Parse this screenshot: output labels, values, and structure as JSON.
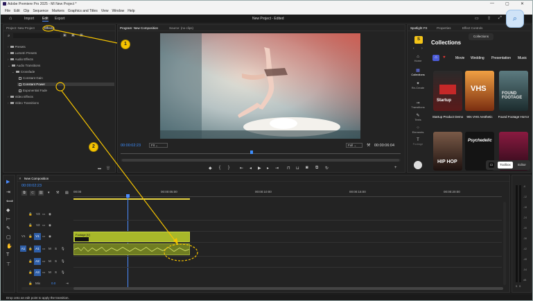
{
  "window": {
    "title": "Adobe Premiere Pro 2025 - MI New Project *",
    "controls": [
      "—",
      "▢",
      "✕"
    ]
  },
  "menu": [
    "File",
    "Edit",
    "Clip",
    "Sequence",
    "Markers",
    "Graphics and Titles",
    "View",
    "Window",
    "Help"
  ],
  "workspace_tabs": [
    "Import",
    "Edit",
    "Export"
  ],
  "project_title": "New Project - Edited",
  "left_panel": {
    "tabs": [
      "Project: New Project",
      "Effects"
    ],
    "tree": [
      {
        "label": "Presets",
        "level": 0
      },
      {
        "label": "Lumetri Presets",
        "level": 0
      },
      {
        "label": "Audio Effects",
        "level": 0
      },
      {
        "label": "Audio Transitions",
        "level": 0
      },
      {
        "label": "Crossfade",
        "level": 1
      },
      {
        "label": "Constant Gain",
        "level": 2
      },
      {
        "label": "Constant Power",
        "level": 2
      },
      {
        "label": "Exponential Fade",
        "level": 2
      },
      {
        "label": "Video Effects",
        "level": 0
      },
      {
        "label": "Video Transitions",
        "level": 0
      }
    ]
  },
  "program_monitor": {
    "tabs": [
      "Program: New Composition",
      "Source: (no clips)"
    ],
    "current_time": "00:00:02:23",
    "fit": "Fit",
    "quality": "Full",
    "duration": "00:00:06:04"
  },
  "right_panel": {
    "tabs": [
      "Spotlight FX",
      "Properties",
      "Effect Controls"
    ],
    "collections_button": "Collections",
    "heading": "Collections",
    "nav_items": [
      "Home",
      "Collections",
      "Re-Create",
      "Transitions",
      "Texts",
      "Elements",
      "Footage"
    ],
    "categories": [
      "Movie",
      "Wedding",
      "Presentation",
      "Music"
    ],
    "cards": [
      {
        "title": "Startup Product Demo",
        "art": "Startup",
        "colors": [
          "#2a2a2a",
          "#b71c1c"
        ]
      },
      {
        "title": "90s VHS Aesthetic",
        "art": "VHS",
        "colors": [
          "#e8742c",
          "#7a2d10"
        ]
      },
      {
        "title": "Found Footage Horror",
        "art": "FOUND FOOTAGE",
        "colors": [
          "#4a6b70",
          "#1c2c2e"
        ]
      }
    ],
    "cards_row2": [
      {
        "art": "HIP HOP",
        "colors": [
          "#6b4a3a",
          "#1e1210"
        ]
      },
      {
        "art": "Psychedelic",
        "colors": [
          "#111111",
          "#222222"
        ]
      },
      {
        "art": "",
        "colors": [
          "#7a1030",
          "#2a0a18"
        ]
      }
    ],
    "toolbox_label": "Toolbox",
    "editor_label": "Editor"
  },
  "timeline": {
    "sequence_tab": "New Composition",
    "current_time": "00:00:02:23",
    "ruler": [
      "00:00",
      "00:00:05:00",
      "00:00:10:00",
      "00:00:15:00",
      "00:00:20:00"
    ],
    "tracks_video": [
      "V3",
      "V2",
      "V1"
    ],
    "tracks_audio": [
      "A1",
      "A2",
      "A3"
    ],
    "mix_label": "Mix",
    "mix_value": "0.0",
    "clip_label": "Footage [V]",
    "meter_labels": [
      "-6",
      "-12",
      "-18",
      "-24",
      "-30",
      "-36",
      "-42",
      "-48",
      "-54",
      "dB"
    ],
    "meter_bottom": [
      "S",
      "S"
    ]
  },
  "status_text": "Drop onto an edit point to apply the transition.",
  "annotations": [
    "1",
    "2"
  ]
}
